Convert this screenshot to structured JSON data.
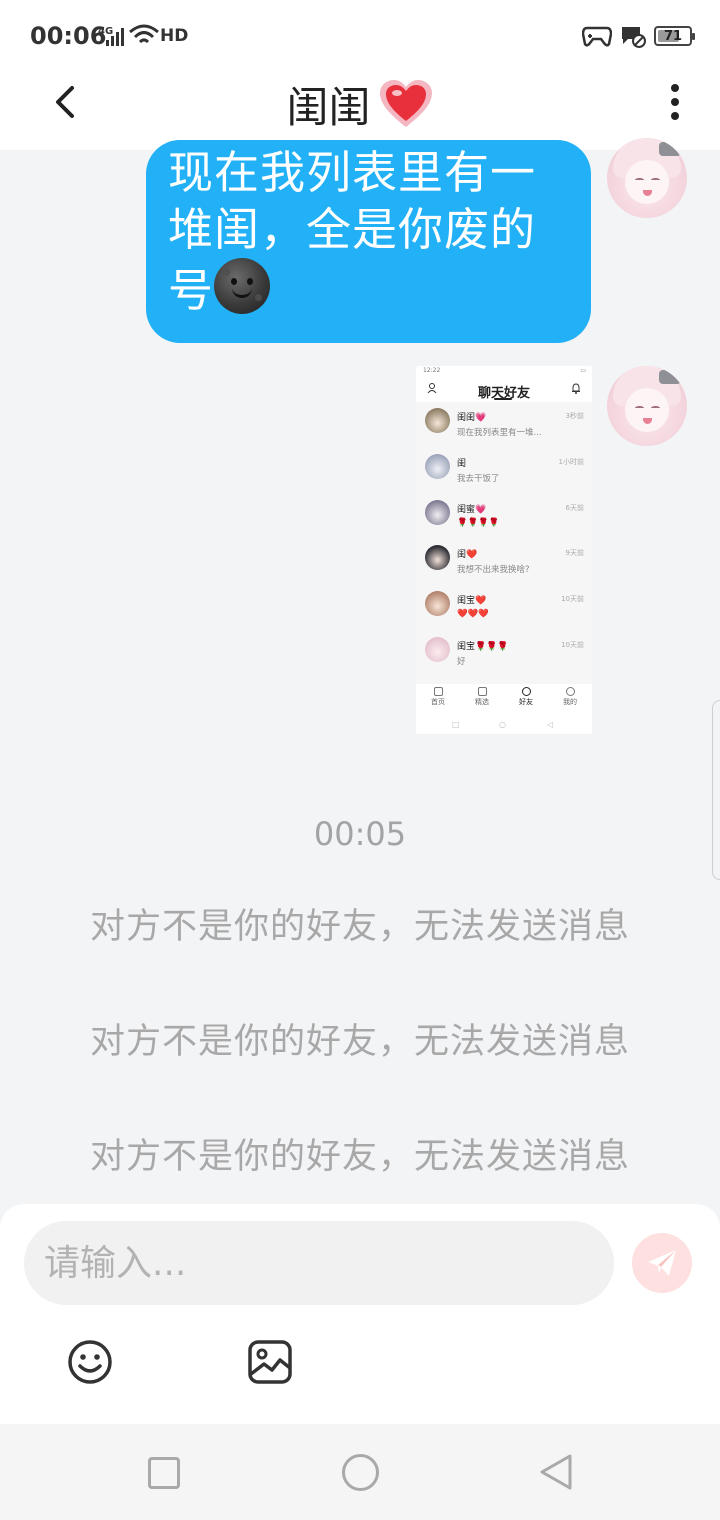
{
  "status_bar": {
    "time": "00:06",
    "network": "4G",
    "hd": "HD",
    "battery": "71",
    "battery_level": 0.71
  },
  "header": {
    "title": "闺闺",
    "title_icon": "sparkling-heart-icon"
  },
  "messages": [
    {
      "type": "text",
      "text": "现在我列表里有一堆闺，全是你废的号",
      "emoji": "new-moon-face-icon",
      "color": "#22b1f6"
    },
    {
      "type": "image",
      "screenshot": {
        "time": "12:22",
        "title": "聊天好友",
        "contacts": [
          {
            "name": "闺闺💗",
            "message": "现在我列表里有一堆...",
            "time": "3秒前"
          },
          {
            "name": "闺",
            "message": "我去干饭了",
            "time": "1小时前"
          },
          {
            "name": "闺蜜💗",
            "message": "🌹🌹🌹🌹",
            "time": "6天前"
          },
          {
            "name": "闺❤️",
            "message": "我想不出来我换啥?",
            "time": "9天前"
          },
          {
            "name": "闺宝❤️",
            "message": "❤️❤️❤️",
            "time": "10天前"
          },
          {
            "name": "闺宝🌹🌹🌹",
            "message": "好",
            "time": "10天前"
          }
        ],
        "tabs": [
          "首页",
          "精选",
          "好友",
          "我的"
        ]
      }
    }
  ],
  "timestamp": "00:05",
  "system_notices": [
    "对方不是你的好友，无法发送消息",
    "对方不是你的好友，无法发送消息",
    "对方不是你的好友，无法发送消息"
  ],
  "input": {
    "placeholder": "请输入..."
  },
  "colors": {
    "bubble": "#22b1f6",
    "send_button": "#fde0df",
    "background": "#f3f4f6"
  }
}
